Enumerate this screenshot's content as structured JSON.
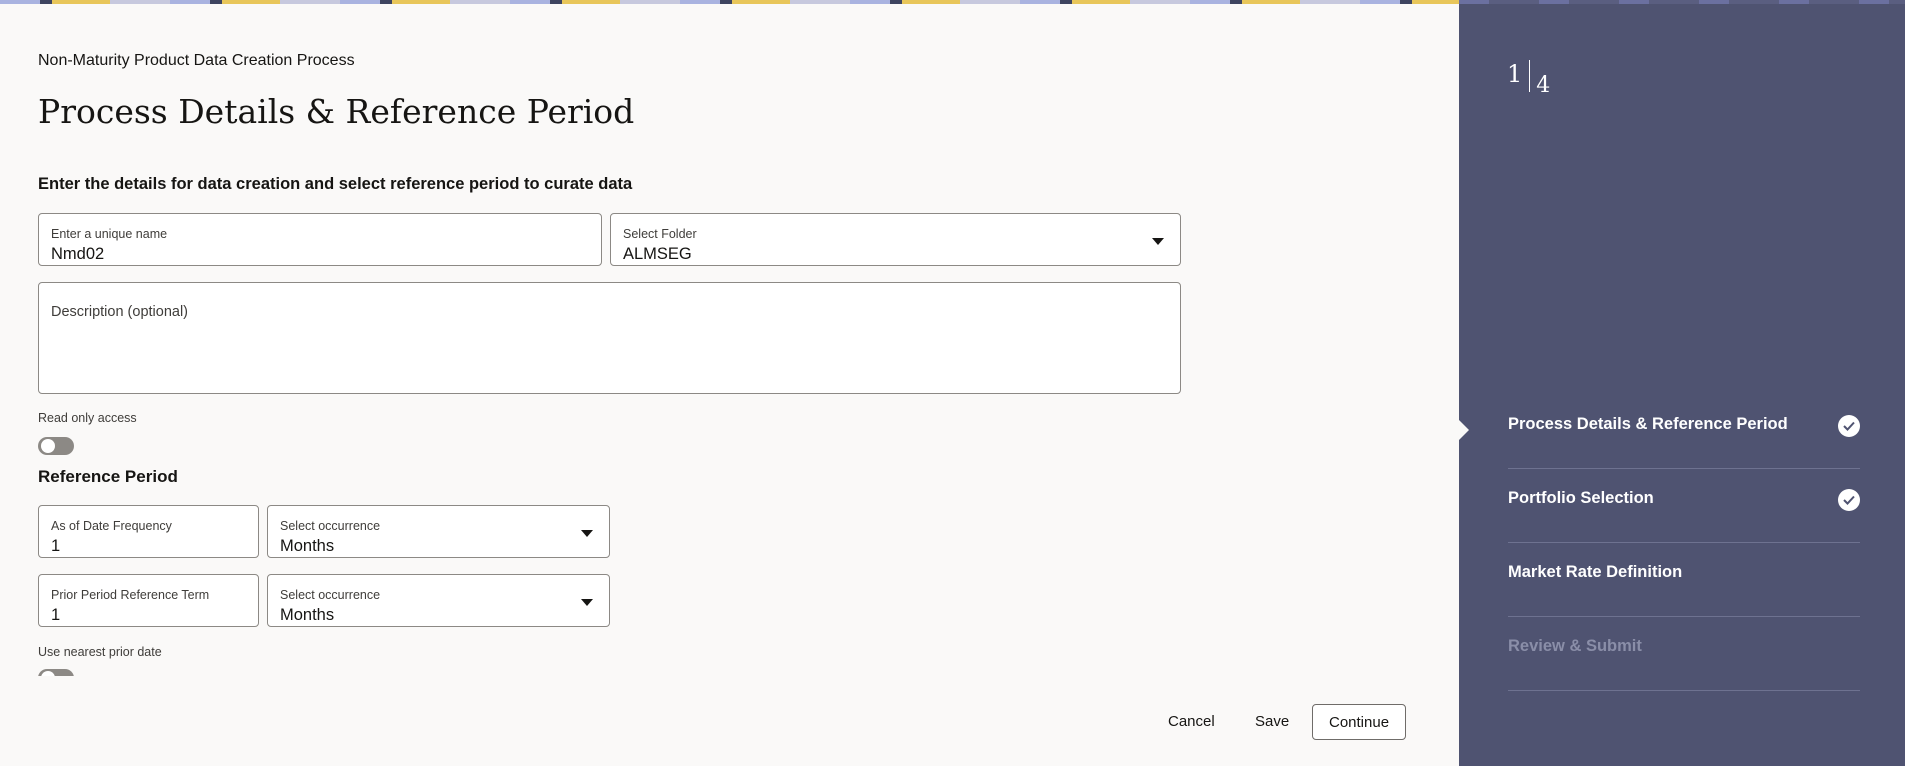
{
  "header": {
    "subtitle": "Non-Maturity Product Data Creation Process",
    "title": "Process Details & Reference Period",
    "instructions": "Enter the details for data creation and select reference period to curate data"
  },
  "form": {
    "name_field": {
      "label": "Enter a unique name",
      "value": "Nmd02"
    },
    "folder_field": {
      "label": "Select Folder",
      "value": "ALMSEG"
    },
    "description_field": {
      "label": "Description (optional)",
      "value": ""
    },
    "read_only": {
      "label": "Read only access",
      "enabled": false
    },
    "reference_period": {
      "title": "Reference Period",
      "as_of_date_frequency": {
        "label": "As of Date Frequency",
        "value": "1"
      },
      "frequency_occurrence": {
        "label": "Select occurrence",
        "value": "Months"
      },
      "prior_period_term": {
        "label": "Prior Period Reference Term",
        "value": "1"
      },
      "term_occurrence": {
        "label": "Select occurrence",
        "value": "Months"
      },
      "use_nearest_prior": {
        "label": "Use nearest prior date",
        "enabled": false
      }
    }
  },
  "footer": {
    "cancel": "Cancel",
    "save": "Save",
    "continue": "Continue"
  },
  "train": {
    "current": "1",
    "total": "4",
    "steps": [
      {
        "label": "Process Details & Reference Period",
        "completed": true
      },
      {
        "label": "Portfolio Selection",
        "completed": true
      },
      {
        "label": "Market Rate Definition",
        "completed": false
      },
      {
        "label": "Review & Submit",
        "completed": false,
        "disabled": true
      }
    ]
  },
  "colors": {
    "sidebar": "#4f5371",
    "background": "#faf9f8",
    "toggle_off": "#8c8985"
  }
}
